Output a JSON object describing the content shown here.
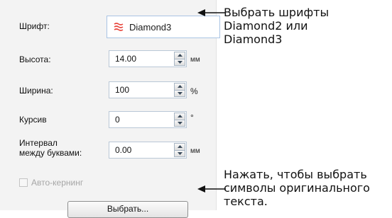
{
  "panel": {
    "font_label": "Шрифт:",
    "font_value": "Diamond3",
    "height_label": "Высота:",
    "height_value": "14.00",
    "height_unit": "мм",
    "width_label": "Ширина:",
    "width_value": "100",
    "width_unit": "%",
    "italic_label": "Курсив",
    "italic_value": "0",
    "italic_unit": "°",
    "spacing_label_line1": "Интервал",
    "spacing_label_line2": "между буквами:",
    "spacing_value": "0.00",
    "spacing_unit": "мм",
    "autokern_label": "Авто-кернинг",
    "autokern_checked": false,
    "button_label": "Выбрать..."
  },
  "callouts": {
    "top": [
      "Выбрать шрифты",
      "Diamond2 или",
      "Diamond3"
    ],
    "bottom": [
      "Нажать, чтобы выбрать",
      "символы оригинального",
      "текста."
    ]
  },
  "colors": {
    "panel_bg": "#f3f3f3",
    "field_border": "#b9c7d6",
    "font_box_border": "#a9c4e4",
    "font_icon": "#e8453c",
    "disabled_text": "#a6a6a6"
  }
}
